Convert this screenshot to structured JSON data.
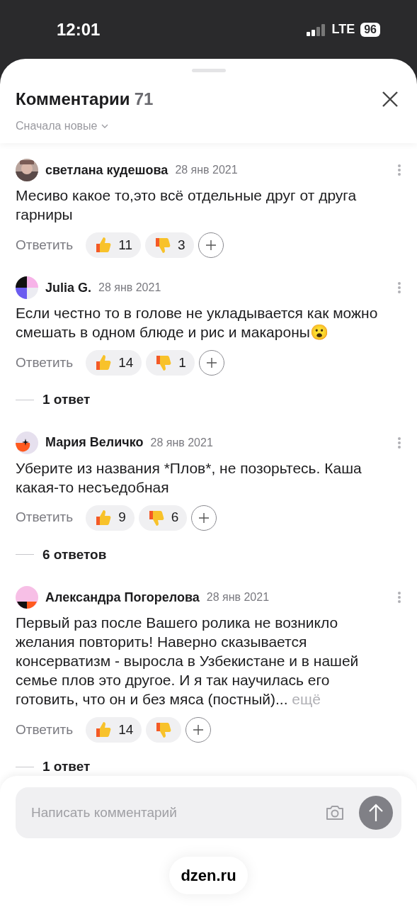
{
  "status_bar": {
    "time": "12:01",
    "network": "LTE",
    "battery": "96"
  },
  "header": {
    "title": "Комментарии",
    "count": "71",
    "sort": "Сначала новые"
  },
  "comments": [
    {
      "author": "светлана кудешова",
      "date": "28 янв 2021",
      "text": "Месиво какое то,это всё отдельные друг от друга гарниры",
      "reply": "Ответить",
      "likes": "11",
      "dislikes": "3"
    },
    {
      "avatar": {
        "kind": "abstract-a"
      },
      "author": "Julia G.",
      "date": "28 янв 2021",
      "text": "Если честно то в голове не укладывается как можно смешать в одном блюде и рис и макароны😮",
      "reply": "Ответить",
      "likes": "14",
      "dislikes": "1",
      "replies": "1 ответ"
    },
    {
      "avatar": {
        "kind": "abstract-b"
      },
      "author": "Мария Величко",
      "date": "28 янв 2021",
      "text": "Уберите из названия *Плов*, не позорьтесь. Каша какая-то несъедобная",
      "reply": "Ответить",
      "likes": "9",
      "dislikes": "6",
      "replies": "6 ответов"
    },
    {
      "avatar": {
        "kind": "abstract-c"
      },
      "author": "Александра Погорелова",
      "date": "28 янв 2021",
      "text": "Первый раз после Вашего ролика не возникло желания повторить! Наверно сказывается консерватизм - выросла в Узбекистане и в нашей семье плов это другое. И я так научилась его готовить, что он и без мяса (постный)...",
      "more": "ещё",
      "reply": "Ответить",
      "likes": "14",
      "replies": "1 ответ"
    }
  ],
  "composer": {
    "placeholder": "Написать комментарий"
  },
  "url_bar": {
    "domain": "dzen.ru"
  }
}
